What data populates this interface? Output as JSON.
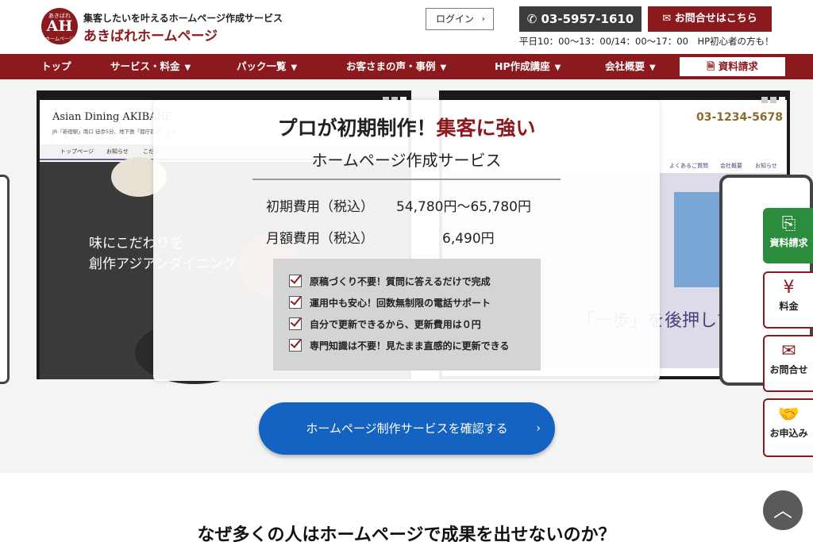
{
  "header": {
    "logo_top": "あきばれ",
    "logo_mid": "AH",
    "logo_bot": "ホームページ",
    "tagline": "集客したいを叶えるホームページ作成サービス",
    "brand": "あきばれホームページ",
    "login": "ログイン",
    "phone": "03-5957-1610",
    "contact": "お問合せはこちら",
    "hours": "平日10：00～13：00/14：00～17：00　HP初心者の方も！"
  },
  "nav": {
    "items": [
      "トップ",
      "サービス・料金",
      "パック一覧",
      "お客さまの声・事例",
      "HP作成講座",
      "会社概要"
    ],
    "doc_request": "資料請求"
  },
  "mock_left": {
    "site_name": "Asian Dining AKIBARE",
    "site_addr": "JR「新宿駅」南口 徒歩5分、地下鉄「都庁前駅」徒歩",
    "nav": [
      "トップページ",
      "お知らせ",
      "こだわ"
    ],
    "photo_text_1": "味にこだわりを",
    "photo_text_2": "創作アジアンダイニング"
  },
  "mock_right": {
    "phone": "03-1234-5678",
    "nav": [
      "よくあるご質問",
      "会社概要",
      "お知らせ"
    ],
    "banner_text": "「一歩」を後押しす"
  },
  "card": {
    "headline_black": "プロが初期制作！",
    "headline_red": "集客に強い",
    "subtitle": "ホームページ作成サービス",
    "initial_label": "初期費用（税込）",
    "initial_value": "54,780円～65,780円",
    "monthly_label": "月額費用（税込）",
    "monthly_value": "6,490円",
    "features": [
      "原稿づくり不要！質問に答えるだけで完成",
      "運用中も安心！回数無制限の電話サポート",
      "自分で更新できるから、更新費用は０円",
      "専門知識は不要！見たまま直感的に更新できる"
    ]
  },
  "cta": {
    "label": "ホームページ制作サービスを確認する"
  },
  "side": {
    "doc": "資料請求",
    "price": "料金",
    "contact": "お問合せ",
    "apply": "お申込み"
  },
  "section": {
    "title": "なぜ多くの人はホームページで成果を出せないのか？"
  },
  "colors": {
    "brand": "#8b1a1f",
    "cta": "#1563c0",
    "green": "#2b8c3e"
  }
}
